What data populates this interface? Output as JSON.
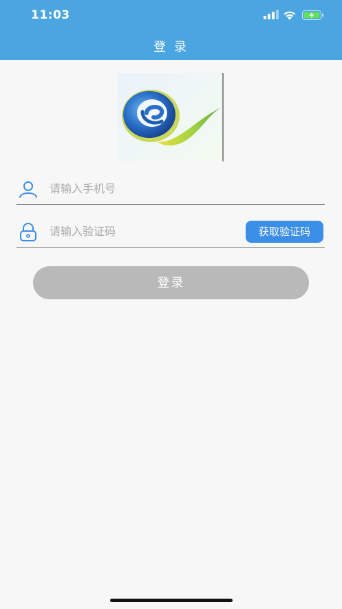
{
  "status_bar": {
    "time": "11:03"
  },
  "header": {
    "title": "登 录"
  },
  "logo": {
    "name": "logo-image"
  },
  "phone": {
    "placeholder": "请输入手机号",
    "value": ""
  },
  "code": {
    "placeholder": "请输入验证码",
    "value": "",
    "button_label": "获取验证码"
  },
  "login": {
    "label": "登录"
  },
  "colors": {
    "header": "#4aa5e0",
    "accent": "#3b8fe6",
    "disabled_button": "#b9b9b9",
    "background": "#f7f7f7"
  },
  "icons": [
    "signal-icon",
    "wifi-icon",
    "battery-icon",
    "user-icon",
    "lock-icon"
  ]
}
